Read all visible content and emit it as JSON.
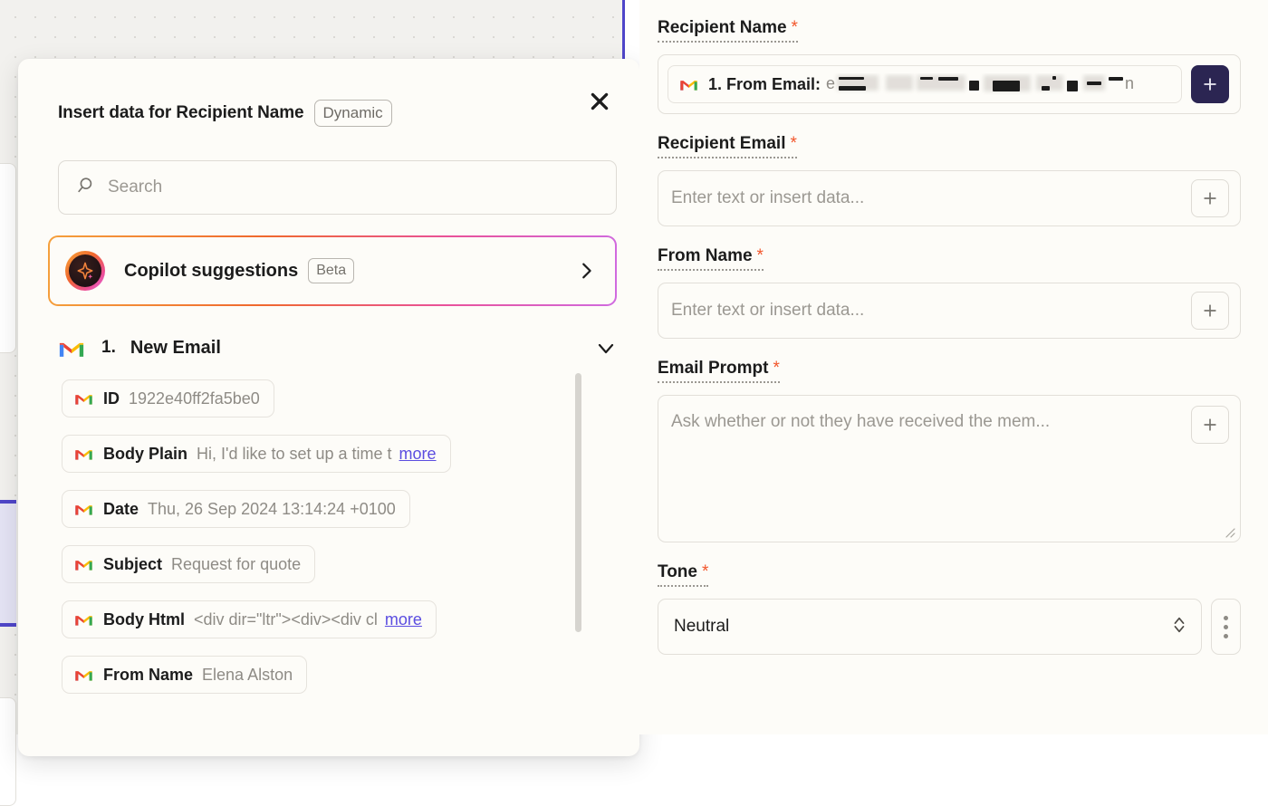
{
  "canvas": {
    "node_labels": [
      "",
      "",
      ""
    ]
  },
  "modal": {
    "title": "Insert data for Recipient Name",
    "mode_badge": "Dynamic",
    "close_icon": "close-icon",
    "search": {
      "placeholder": "Search",
      "value": "",
      "icon": "search-icon"
    },
    "copilot": {
      "label": "Copilot suggestions",
      "badge": "Beta",
      "icon": "sparkle-icon",
      "chevron": "chevron-right-icon"
    },
    "group": {
      "icon": "gmail-icon",
      "number": "1.",
      "title": "New Email",
      "chevron": "chevron-down-icon"
    },
    "fields": [
      {
        "icon": "gmail-icon",
        "key": "ID",
        "value": "1922e40ff2fa5be0",
        "more": ""
      },
      {
        "icon": "gmail-icon",
        "key": "Body Plain",
        "value": "Hi, I'd like to set up a time t",
        "more": "more"
      },
      {
        "icon": "gmail-icon",
        "key": "Date",
        "value": "Thu, 26 Sep 2024 13:14:24 +0100",
        "more": ""
      },
      {
        "icon": "gmail-icon",
        "key": "Subject",
        "value": "Request for quote",
        "more": ""
      },
      {
        "icon": "gmail-icon",
        "key": "Body Html",
        "value": "<div dir=\"ltr\"><div><div cl",
        "more": "more"
      },
      {
        "icon": "gmail-icon",
        "key": "From Name",
        "value": "Elena Alston",
        "more": ""
      }
    ]
  },
  "form": {
    "required_marker": "*",
    "fields": {
      "recipient_name": {
        "label": "Recipient Name",
        "token_icon": "gmail-icon",
        "token_label": "1. From Email:",
        "token_value_redacted": "e█████████████████n",
        "add_button": "+"
      },
      "recipient_email": {
        "label": "Recipient Email",
        "placeholder": "Enter text or insert data...",
        "value": "",
        "add_button": "+"
      },
      "from_name": {
        "label": "From Name",
        "placeholder": "Enter text or insert data...",
        "value": "",
        "add_button": "+"
      },
      "email_prompt": {
        "label": "Email Prompt",
        "placeholder": "Ask whether or not they have received the mem...",
        "value": "",
        "add_button": "+"
      },
      "tone": {
        "label": "Tone",
        "value": "Neutral",
        "stepper_icon": "chevron-up-down-icon",
        "menu_icon": "kebab-menu-icon"
      }
    }
  },
  "colors": {
    "accent_navy": "#2b2552",
    "accent_indigo": "#4f46c9",
    "required_red": "#f2562b",
    "link_purple": "#5b4de0",
    "panel_bg": "#fdfcf8",
    "canvas_bg": "#f2f1ee"
  }
}
